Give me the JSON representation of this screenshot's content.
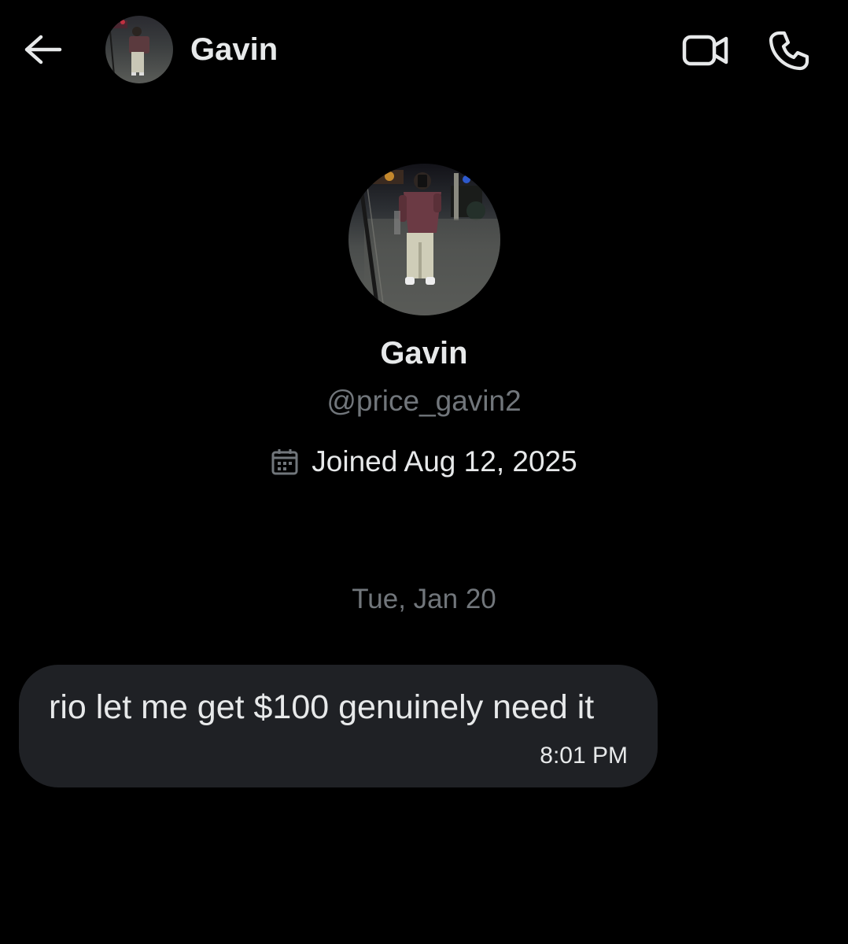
{
  "header": {
    "back_icon": "arrow-left-icon",
    "contact_name": "Gavin",
    "video_icon": "video-camera-icon",
    "phone_icon": "phone-icon"
  },
  "profile": {
    "name": "Gavin",
    "handle": "@price_gavin2",
    "joined_icon": "calendar-icon",
    "joined_text": "Joined Aug 12, 2025"
  },
  "conversation": {
    "date_divider": "Tue, Jan 20",
    "messages": [
      {
        "text": "rio let me get $100 genuinely need it",
        "time": "8:01 PM",
        "direction": "incoming"
      }
    ]
  },
  "colors": {
    "background": "#000000",
    "primary_text": "#e7e9ea",
    "secondary_text": "#71767b",
    "bubble_incoming": "#1f2125"
  }
}
